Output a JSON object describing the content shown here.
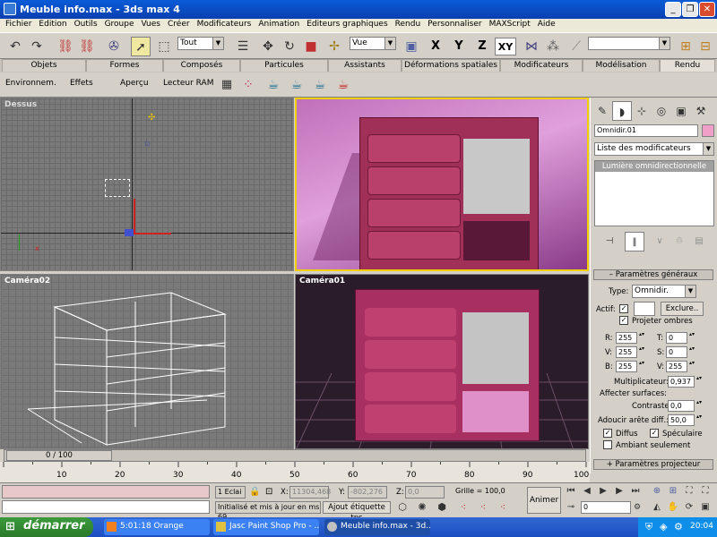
{
  "window": {
    "title": "Meuble info.max - 3ds max 4"
  },
  "menu": [
    "Fichier",
    "Edition",
    "Outils",
    "Groupe",
    "Vues",
    "Créer",
    "Modificateurs",
    "Animation",
    "Editeurs graphiques",
    "Rendu",
    "Personnaliser",
    "MAXScript",
    "Aide"
  ],
  "toolbar": {
    "selection_filter": "Tout",
    "ref_coord": "Vue",
    "axis_x": "X",
    "axis_y": "Y",
    "axis_z": "Z",
    "axis_xy": "XY",
    "named_selection": ""
  },
  "tabs": [
    "Objets",
    "Formes",
    "Composés",
    "Particules",
    "Assistants",
    "Déformations spatiales",
    "Modificateurs",
    "Modélisation",
    "Rendu"
  ],
  "render_toolbar": {
    "environment": "Environnem.",
    "effects": "Effets",
    "preview": "Aperçu",
    "ram_player": "Lecteur RAM"
  },
  "viewports": {
    "top": "Dessus",
    "perspective": "",
    "camera02": "Caméra02",
    "camera01": "Caméra01"
  },
  "command_panel": {
    "object_name": "Omnidir.01",
    "object_color": "#f0a0c8",
    "modifier_list": "Liste des modificateurs",
    "stack_item": "Lumière omnidirectionnelle",
    "general_rollout": "Paramètres généraux",
    "type_label": "Type:",
    "type_value": "Omnidir.",
    "on_label": "Actif:",
    "exclude_label": "Exclure..",
    "cast_shadows_label": "Projeter ombres",
    "r_label": "R:",
    "r_value": "255",
    "g_label": "V:",
    "g_value": "255",
    "b_label": "B:",
    "b_value": "255",
    "h_label": "T:",
    "h_value": "0",
    "s_label": "S:",
    "s_value": "0",
    "v_label": "V:",
    "v_value": "255",
    "multiplier_label": "Multiplicateur:",
    "multiplier_value": "0,937",
    "affect_surfaces_label": "Affecter surfaces:",
    "contrast_label": "Contraste:",
    "contrast_value": "0,0",
    "soften_label": "Adoucir arête diff.:",
    "soften_value": "50,0",
    "diffuse_label": "Diffus",
    "specular_label": "Spéculaire",
    "ambient_only_label": "Ambiant seulement",
    "projector_rollout": "Paramètres projecteur"
  },
  "timeline": {
    "frame_display": "0 / 100",
    "ticks": [
      "10",
      "20",
      "30",
      "40",
      "50",
      "60",
      "70",
      "80",
      "90",
      "100"
    ]
  },
  "status": {
    "selection": "1 Eclai",
    "x_label": "X:",
    "x_value": "11304,468",
    "y_label": "Y:",
    "y_value": "-802,276",
    "z_label": "Z:",
    "z_value": "0,0",
    "grid": "Grille = 100,0",
    "prompt": "Initialisé et mis à jour en ms 69",
    "add_time_tag": "Ajout étiquette tps",
    "animate_button": "Animer",
    "current_frame": "0"
  },
  "taskbar": {
    "start": "démarrer",
    "items": [
      "5:01:18 Orange",
      "Jasc Paint Shop Pro - ...",
      "Meuble info.max - 3d..."
    ],
    "clock": "20:04"
  }
}
